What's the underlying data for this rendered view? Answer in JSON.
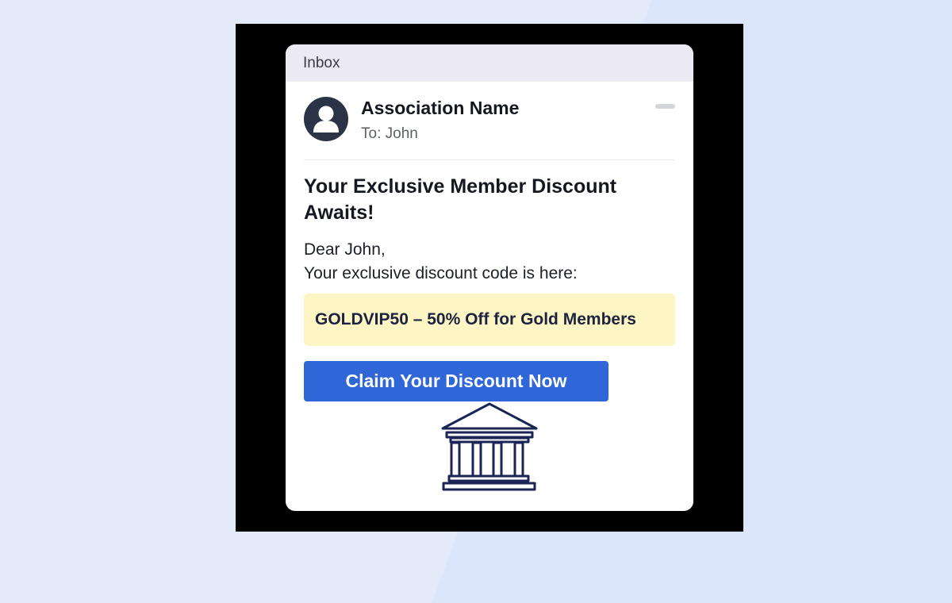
{
  "inbox": {
    "title": "Inbox"
  },
  "email": {
    "sender_name": "Association Name",
    "recipient": "To: John",
    "subject": "Your Exclusive Member Discount Awaits!",
    "greeting": "Dear John,",
    "intro": "Your exclusive discount code is here:",
    "discount_code": "GOLDVIP50 – 50% Off for Gold Members",
    "cta_label": "Claim Your Discount Now"
  },
  "icons": {
    "avatar": "user-avatar-icon",
    "menu": "minus-icon",
    "illustration": "bank-building-icon"
  },
  "colors": {
    "page_background": "#e3ebfb",
    "frame": "#000000",
    "inbox_bar": "#ebe9f4",
    "avatar": "#2b3346",
    "code_highlight": "#fdf5c3",
    "cta_button": "#2f66d8",
    "illustration_stroke": "#1b2555"
  }
}
